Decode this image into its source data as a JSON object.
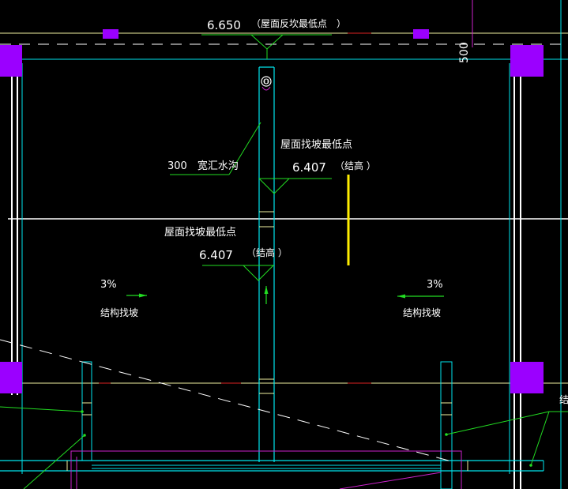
{
  "colors": {
    "background": "#000000",
    "cyan": "#00e5ee",
    "green": "#22dd22",
    "white": "#ffffff",
    "magenta": "#cc22cc",
    "purple_fill": "#9b00ff",
    "yellow": "#ffee00",
    "red": "#dd2222",
    "light_yellow": "#f0f0a0"
  },
  "annotations": {
    "top_elevation_value": "6.650",
    "top_elevation_note": "（屋面反坎最低点　）",
    "dimension_500": "500",
    "gutter_label": "300　宽汇水沟",
    "upper_slope_title": "屋面找坡最低点",
    "upper_elevation_value": "6.407",
    "upper_elevation_note": "（结高 ）",
    "lower_slope_title": "屋面找坡最低点",
    "lower_elevation_value": "6.407",
    "lower_elevation_note": "（结高 ）",
    "left_slope_percent": "3%",
    "left_slope_label": "结构找坡",
    "right_slope_percent": "3%",
    "right_slope_label": "结构找坡",
    "right_edge_text": "结"
  },
  "icons": {
    "drain": "floor-drain-icon",
    "elevation_marker": "elevation-triangle-icon",
    "slope_arrow": "slope-arrow-icon"
  }
}
